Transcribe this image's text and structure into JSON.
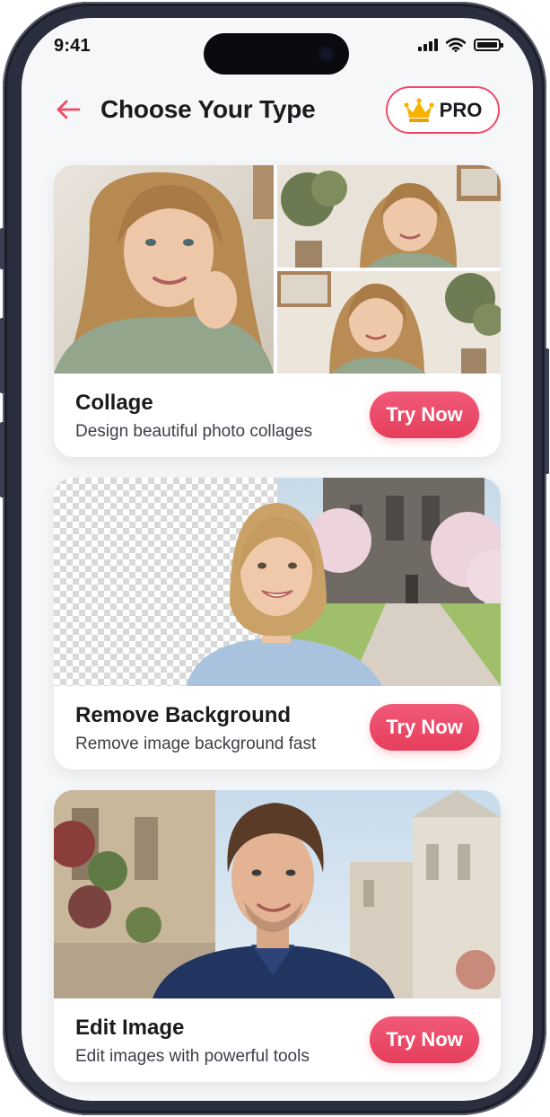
{
  "status_bar": {
    "time": "9:41"
  },
  "header": {
    "title": "Choose Your Type",
    "pro_label": "PRO"
  },
  "cards": [
    {
      "title": "Collage",
      "description": "Design beautiful photo collages",
      "button": "Try Now"
    },
    {
      "title": "Remove Background",
      "description": "Remove image background fast",
      "button": "Try Now"
    },
    {
      "title": "Edit Image",
      "description": "Edit images with powerful tools",
      "button": "Try Now"
    }
  ],
  "icons": {
    "back": "arrow-left-icon",
    "crown": "crown-icon",
    "signal": "cellular-signal-icon",
    "wifi": "wifi-icon",
    "battery": "battery-icon"
  },
  "colors": {
    "accent": "#ef4b67",
    "button_top": "#f05a78",
    "button_bottom": "#e63e5c",
    "crown": "#f6b400",
    "background": "#f6f7f9"
  }
}
